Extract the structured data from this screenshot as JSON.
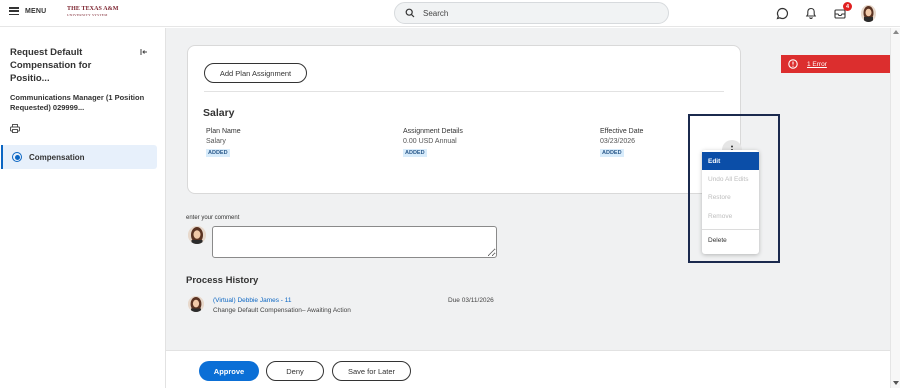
{
  "header": {
    "menu_label": "MENU",
    "logo_main": "THE TEXAS A&M",
    "logo_sub": "UNIVERSITY SYSTEM",
    "search_placeholder": "Search",
    "notification_badge": "4"
  },
  "task": {
    "title": "Request Default Compensation for Positio...",
    "subtitle": "Communications Manager (1 Position Requested) 029999...",
    "nav_items": [
      {
        "label": "Compensation",
        "selected": true
      }
    ]
  },
  "card": {
    "add_plan_label": "Add Plan Assignment",
    "section_title": "Salary",
    "columns": [
      {
        "header": "Plan Name",
        "value": "Salary",
        "tag": "ADDED"
      },
      {
        "header": "Assignment Details",
        "value": "0.00 USD Annual",
        "tag": "ADDED"
      },
      {
        "header": "Effective Date",
        "value": "03/23/2026",
        "tag": "ADDED"
      }
    ]
  },
  "menu": {
    "items": [
      {
        "label": "Edit",
        "state": "active"
      },
      {
        "label": "Undo All Edits",
        "state": "disabled"
      },
      {
        "label": "Restore",
        "state": "disabled"
      },
      {
        "label": "Remove",
        "state": "disabled"
      },
      {
        "label": "Delete",
        "state": "normal"
      }
    ]
  },
  "comment": {
    "label": "enter your comment",
    "value": ""
  },
  "process_history": {
    "title": "Process History",
    "person": "(Virtual) Debbie James - 11",
    "due": "Due 03/11/2026",
    "description": "Change Default Compensation– Awaiting Action"
  },
  "footer": {
    "approve_label": "Approve",
    "deny_label": "Deny",
    "save_label": "Save for Later"
  },
  "error": {
    "label": "1 Error"
  },
  "colors": {
    "accent": "#0b6fd6",
    "error": "#dc2e2e",
    "tag_bg": "#d8ecfb",
    "highlight_border": "#1b2a4e"
  }
}
